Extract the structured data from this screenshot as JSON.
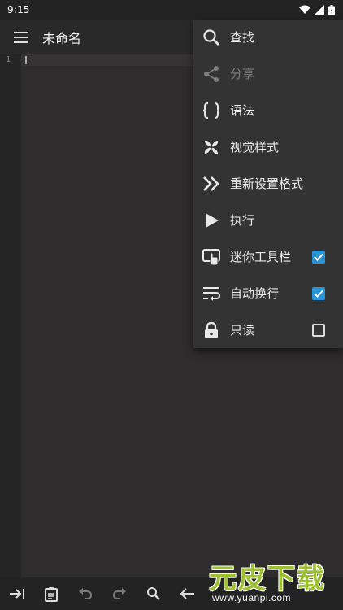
{
  "status_bar": {
    "time": "9:15"
  },
  "app_bar": {
    "title": "未命名"
  },
  "editor": {
    "line_numbers": [
      "1"
    ]
  },
  "menu": {
    "items": [
      {
        "label": "查找",
        "icon": "search-icon",
        "enabled": true
      },
      {
        "label": "分享",
        "icon": "share-icon",
        "enabled": false
      },
      {
        "label": "语法",
        "icon": "braces-icon",
        "enabled": true
      },
      {
        "label": "视觉样式",
        "icon": "pinwheel-icon",
        "enabled": true
      },
      {
        "label": "重新设置格式",
        "icon": "double-chevron-icon",
        "enabled": true
      },
      {
        "label": "执行",
        "icon": "play-icon",
        "enabled": true
      },
      {
        "label": "迷你工具栏",
        "icon": "touch-screen-icon",
        "enabled": true,
        "checked": true
      },
      {
        "label": "自动换行",
        "icon": "wrap-text-icon",
        "enabled": true,
        "checked": true
      },
      {
        "label": "只读",
        "icon": "lock-icon",
        "enabled": true,
        "checked": false
      }
    ]
  },
  "bottom_toolbar": {
    "icons": [
      "tab-indent-icon",
      "clipboard-icon",
      "undo-icon",
      "redo-icon",
      "search-icon",
      "arrow-left-icon"
    ]
  },
  "watermark": {
    "text": "元皮下载",
    "url": "www.yuanpi.com"
  },
  "colors": {
    "accent": "#2a94d8",
    "background": "#2e2c2c",
    "menu": "#343333"
  }
}
